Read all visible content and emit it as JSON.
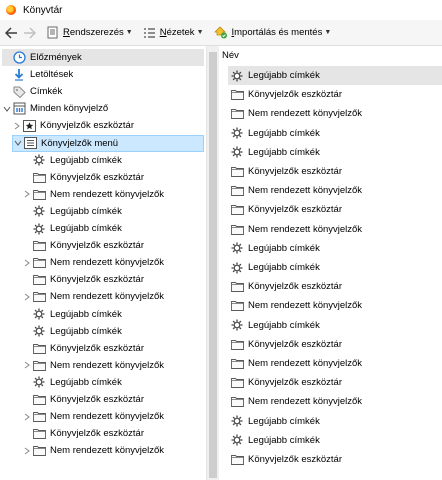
{
  "window": {
    "title": "Könyvtár"
  },
  "toolbar": {
    "organize": {
      "mnemonic": "R",
      "rest": "endszerezés"
    },
    "views": {
      "mnemonic": "N",
      "rest": "ézetek"
    },
    "import": {
      "mnemonic": "I",
      "rest": "mportálás és mentés"
    }
  },
  "sidebar": {
    "items": [
      {
        "label": "Előzmények",
        "icon": "clock-icon",
        "indent": 0,
        "twisty": "",
        "state": "hovered"
      },
      {
        "label": "Letöltések",
        "icon": "download-arrow-icon",
        "indent": 0,
        "twisty": "",
        "state": ""
      },
      {
        "label": "Címkék",
        "icon": "tag-icon",
        "indent": 0,
        "twisty": "",
        "state": ""
      },
      {
        "label": "Minden könyvjelző",
        "icon": "library-icon",
        "indent": 0,
        "twisty": "v",
        "state": ""
      },
      {
        "label": "Könyvjelzők eszköztár",
        "icon": "bookmarks-toolbar-icon",
        "indent": 1,
        "twisty": ">",
        "state": ""
      },
      {
        "label": "Könyvjelzők menü",
        "icon": "bookmarks-menu-icon",
        "indent": 1,
        "twisty": "v",
        "state": "selected"
      },
      {
        "label": "Legújabb címkék",
        "icon": "gear-icon",
        "indent": 2,
        "twisty": "",
        "state": ""
      },
      {
        "label": "Könyvjelzők eszköztár",
        "icon": "folder-icon",
        "indent": 2,
        "twisty": "",
        "state": ""
      },
      {
        "label": "Nem rendezett könyvjelzők",
        "icon": "folder-icon",
        "indent": 2,
        "twisty": ">",
        "state": ""
      },
      {
        "label": "Legújabb címkék",
        "icon": "gear-icon",
        "indent": 2,
        "twisty": "",
        "state": ""
      },
      {
        "label": "Legújabb címkék",
        "icon": "gear-icon",
        "indent": 2,
        "twisty": "",
        "state": ""
      },
      {
        "label": "Könyvjelzők eszköztár",
        "icon": "folder-icon",
        "indent": 2,
        "twisty": "",
        "state": ""
      },
      {
        "label": "Nem rendezett könyvjelzők",
        "icon": "folder-icon",
        "indent": 2,
        "twisty": ">",
        "state": ""
      },
      {
        "label": "Könyvjelzők eszköztár",
        "icon": "folder-icon",
        "indent": 2,
        "twisty": "",
        "state": ""
      },
      {
        "label": "Nem rendezett könyvjelzők",
        "icon": "folder-icon",
        "indent": 2,
        "twisty": ">",
        "state": ""
      },
      {
        "label": "Legújabb címkék",
        "icon": "gear-icon",
        "indent": 2,
        "twisty": "",
        "state": ""
      },
      {
        "label": "Legújabb címkék",
        "icon": "gear-icon",
        "indent": 2,
        "twisty": "",
        "state": ""
      },
      {
        "label": "Könyvjelzők eszköztár",
        "icon": "folder-icon",
        "indent": 2,
        "twisty": "",
        "state": ""
      },
      {
        "label": "Nem rendezett könyvjelzők",
        "icon": "folder-icon",
        "indent": 2,
        "twisty": ">",
        "state": ""
      },
      {
        "label": "Legújabb címkék",
        "icon": "gear-icon",
        "indent": 2,
        "twisty": "",
        "state": ""
      },
      {
        "label": "Könyvjelzők eszköztár",
        "icon": "folder-icon",
        "indent": 2,
        "twisty": "",
        "state": ""
      },
      {
        "label": "Nem rendezett könyvjelzők",
        "icon": "folder-icon",
        "indent": 2,
        "twisty": ">",
        "state": ""
      },
      {
        "label": "Könyvjelzők eszköztár",
        "icon": "folder-icon",
        "indent": 2,
        "twisty": "",
        "state": ""
      },
      {
        "label": "Nem rendezett könyvjelzők",
        "icon": "folder-icon",
        "indent": 2,
        "twisty": ">",
        "state": ""
      }
    ]
  },
  "main": {
    "column_header": "Név",
    "rows": [
      {
        "label": "Legújabb címkék",
        "icon": "gear-icon",
        "state": "hovered"
      },
      {
        "label": "Könyvjelzők eszköztár",
        "icon": "folder-icon",
        "state": ""
      },
      {
        "label": "Nem rendezett könyvjelzők",
        "icon": "folder-icon",
        "state": ""
      },
      {
        "label": "Legújabb címkék",
        "icon": "gear-icon",
        "state": ""
      },
      {
        "label": "Legújabb címkék",
        "icon": "gear-icon",
        "state": ""
      },
      {
        "label": "Könyvjelzők eszköztár",
        "icon": "folder-icon",
        "state": ""
      },
      {
        "label": "Nem rendezett könyvjelzők",
        "icon": "folder-icon",
        "state": ""
      },
      {
        "label": "Könyvjelzők eszköztár",
        "icon": "folder-icon",
        "state": ""
      },
      {
        "label": "Nem rendezett könyvjelzők",
        "icon": "folder-icon",
        "state": ""
      },
      {
        "label": "Legújabb címkék",
        "icon": "gear-icon",
        "state": ""
      },
      {
        "label": "Legújabb címkék",
        "icon": "gear-icon",
        "state": ""
      },
      {
        "label": "Könyvjelzők eszköztár",
        "icon": "folder-icon",
        "state": ""
      },
      {
        "label": "Nem rendezett könyvjelzők",
        "icon": "folder-icon",
        "state": ""
      },
      {
        "label": "Legújabb címkék",
        "icon": "gear-icon",
        "state": ""
      },
      {
        "label": "Könyvjelzők eszköztár",
        "icon": "folder-icon",
        "state": ""
      },
      {
        "label": "Nem rendezett könyvjelzők",
        "icon": "folder-icon",
        "state": ""
      },
      {
        "label": "Könyvjelzők eszköztár",
        "icon": "folder-icon",
        "state": ""
      },
      {
        "label": "Nem rendezett könyvjelzők",
        "icon": "folder-icon",
        "state": ""
      },
      {
        "label": "Legújabb címkék",
        "icon": "gear-icon",
        "state": ""
      },
      {
        "label": "Legújabb címkék",
        "icon": "gear-icon",
        "state": ""
      },
      {
        "label": "Könyvjelzők eszköztár",
        "icon": "folder-icon",
        "state": ""
      }
    ]
  },
  "colors": {
    "selection_fill": "#cce8ff",
    "selection_border": "#99d1ff",
    "hover_fill": "#e5e5e5",
    "toolbar_bg": "#f6f6f6"
  }
}
